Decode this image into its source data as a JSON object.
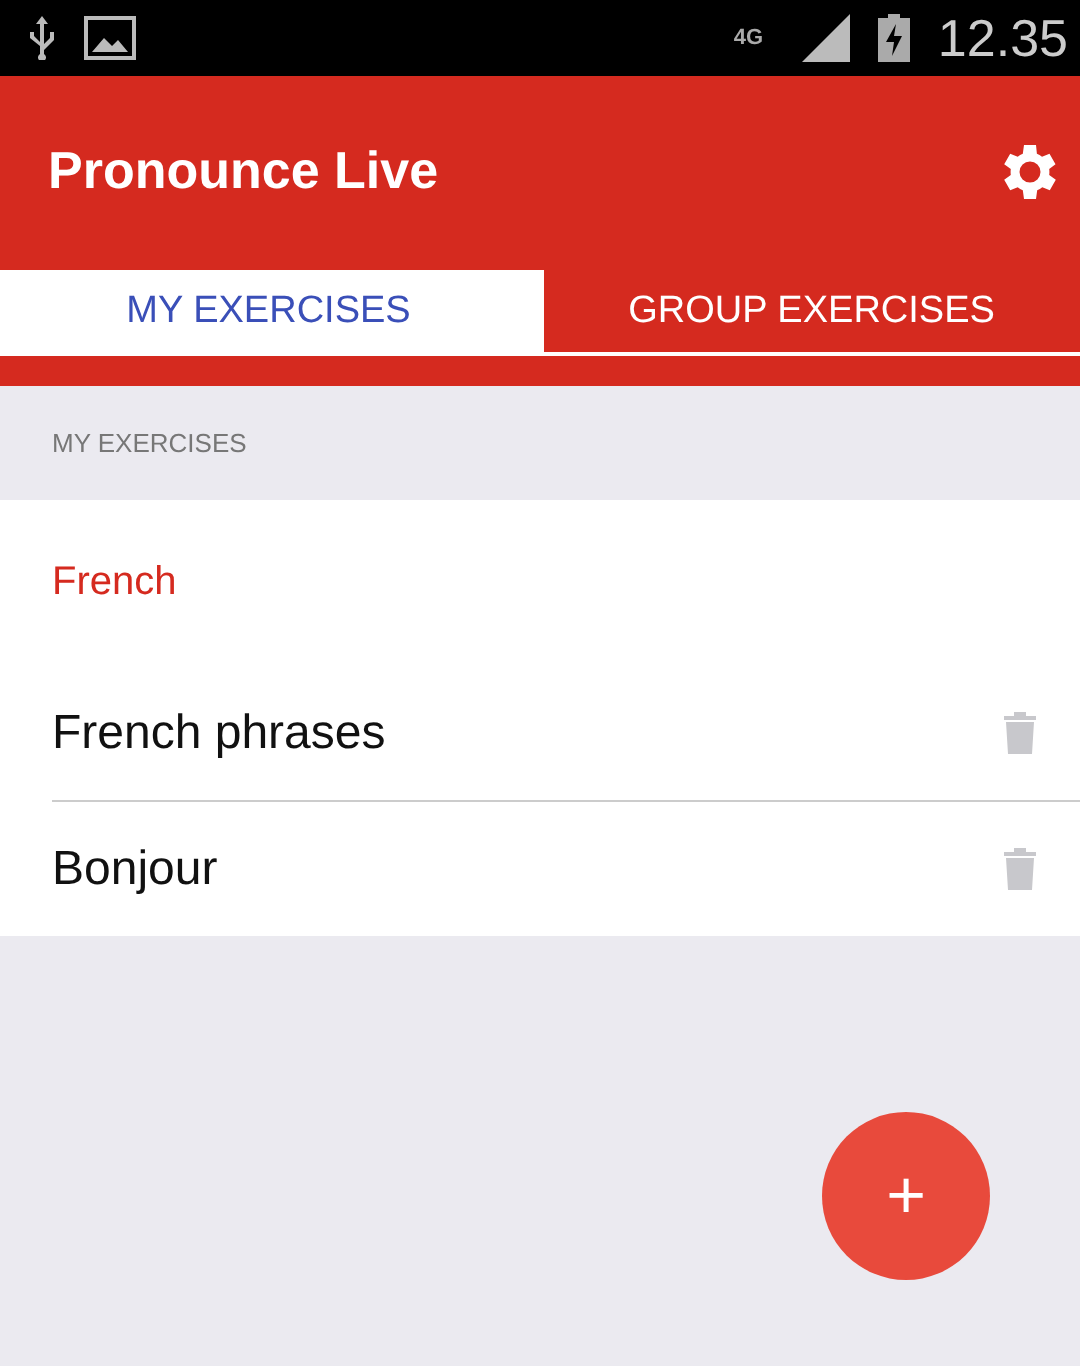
{
  "status_bar": {
    "network": "4G",
    "time": "12.35"
  },
  "app_bar": {
    "title": "Pronounce Live"
  },
  "tabs": [
    {
      "label": "MY EXERCISES",
      "selected": true
    },
    {
      "label": "GROUP EXERCISES",
      "selected": false
    }
  ],
  "section": {
    "header": "MY EXERCISES",
    "group": "French",
    "items": [
      {
        "name": "French phrases"
      },
      {
        "name": "Bonjour"
      }
    ]
  },
  "fab": {
    "label": "+"
  }
}
